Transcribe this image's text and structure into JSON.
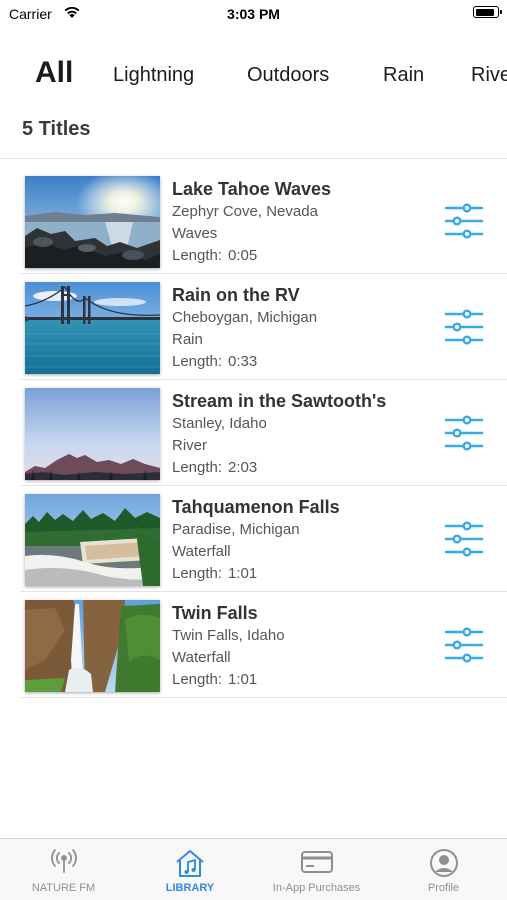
{
  "status_bar": {
    "carrier": "Carrier",
    "time": "3:03 PM"
  },
  "categories": [
    {
      "label": "All",
      "active": true
    },
    {
      "label": "Lightning",
      "active": false
    },
    {
      "label": "Outdoors",
      "active": false
    },
    {
      "label": "Rain",
      "active": false
    },
    {
      "label": "River",
      "active": false
    }
  ],
  "count_label": "5 Titles",
  "length_label": "Length:",
  "titles": [
    {
      "title": "Lake Tahoe Waves",
      "location": "Zephyr Cove, Nevada",
      "category": "Waves",
      "length": "0:05",
      "image": "lake-tahoe-thumbnail"
    },
    {
      "title": "Rain on the RV",
      "location": "Cheboygan, Michigan",
      "category": "Rain",
      "length": "0:33",
      "image": "bridge-lake-thumbnail"
    },
    {
      "title": "Stream in the Sawtooth's",
      "location": "Stanley, Idaho",
      "category": "River",
      "length": "2:03",
      "image": "sawtooth-mountains-thumbnail"
    },
    {
      "title": "Tahquamenon Falls",
      "location": "Paradise, Michigan",
      "category": "Waterfall",
      "length": "1:01",
      "image": "tahquamenon-falls-thumbnail"
    },
    {
      "title": "Twin Falls",
      "location": "Twin Falls, Idaho",
      "category": "Waterfall",
      "length": "1:01",
      "image": "twin-falls-thumbnail"
    }
  ],
  "tab_bar": [
    {
      "label": "NATURE FM",
      "icon": "radio-antenna-icon",
      "active": false
    },
    {
      "label": "LIBRARY",
      "icon": "music-house-icon",
      "active": true
    },
    {
      "label": "In-App Purchases",
      "icon": "credit-card-icon",
      "active": false
    },
    {
      "label": "Profile",
      "icon": "person-circle-icon",
      "active": false
    }
  ],
  "colors": {
    "accent": "#2f8ae0",
    "slider_icon": "#3aa9e4",
    "inactive": "#8e8e93"
  }
}
